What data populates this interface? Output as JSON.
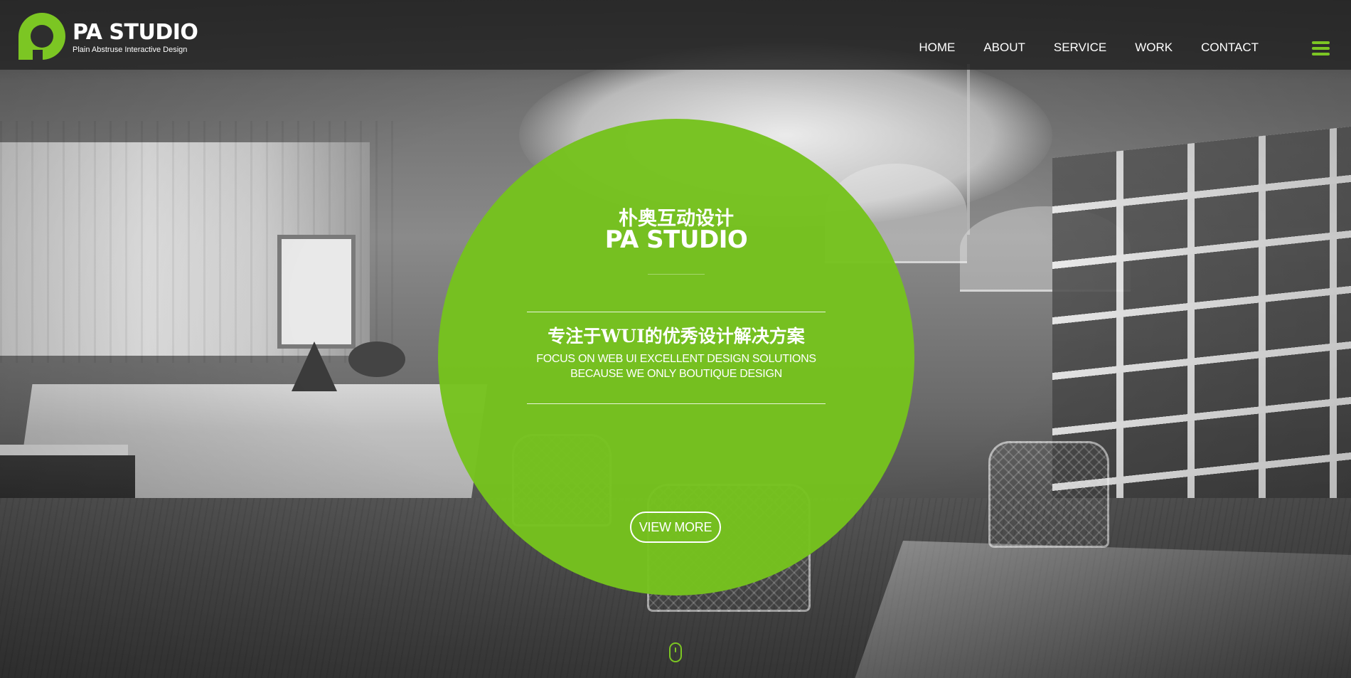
{
  "brand": {
    "name": "PA STUDIO",
    "tagline": "Plain Abstruse Interactive Design",
    "accent_color": "#7cc623"
  },
  "nav": {
    "items": [
      {
        "label": "HOME"
      },
      {
        "label": "ABOUT"
      },
      {
        "label": "SERVICE"
      },
      {
        "label": "WORK"
      },
      {
        "label": "CONTACT"
      }
    ],
    "menu_icon": "hamburger-menu-icon"
  },
  "hero": {
    "cn_title": "朴奥互动设计",
    "en_title": "PA STUDIO",
    "cn_slogan": "专注于WUI的优秀设计解决方案",
    "en_slogan": "FOCUS ON WEB UI EXCELLENT DESIGN SOLUTIONS BECAUSE WE ONLY BOUTIQUE DESIGN",
    "button_label": "VIEW MORE",
    "circle_color": "#76c21e"
  },
  "scroll_indicator": {
    "icon": "mouse-scroll-icon"
  }
}
